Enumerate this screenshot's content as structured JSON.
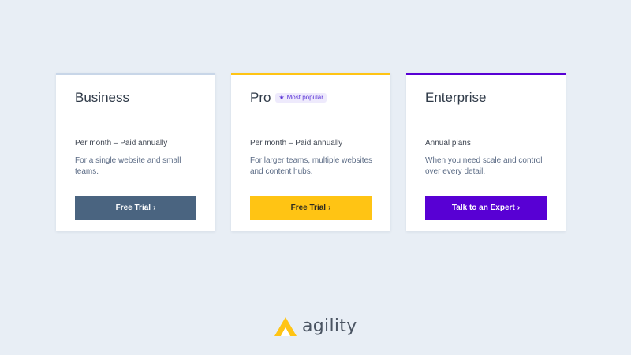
{
  "colors": {
    "background": "#e8eef5",
    "business_accent": "#c8d6e8",
    "business_button": "#4a6480",
    "pro_accent": "#ffc414",
    "pro_button": "#ffc414",
    "enterprise_accent": "#5800d4",
    "enterprise_button": "#5800d4",
    "logo_mark": "#ffc414"
  },
  "plans": [
    {
      "name": "Business",
      "billing": "Per month – Paid annually",
      "description": "For a single website and small teams.",
      "cta_label": "Free Trial",
      "cta_icon": "chevron-right-icon"
    },
    {
      "name": "Pro",
      "badge": "Most popular",
      "badge_icon": "star-icon",
      "billing": "Per month – Paid annually",
      "description": "For larger teams, multiple websites and content hubs.",
      "cta_label": "Free Trial",
      "cta_icon": "chevron-right-icon"
    },
    {
      "name": "Enterprise",
      "billing": "Annual plans",
      "description": "When you need scale and control over every detail.",
      "cta_label": "Talk to an Expert",
      "cta_icon": "chevron-right-icon"
    }
  ],
  "logo": {
    "text": "agility",
    "icon": "agility-logo-icon"
  }
}
